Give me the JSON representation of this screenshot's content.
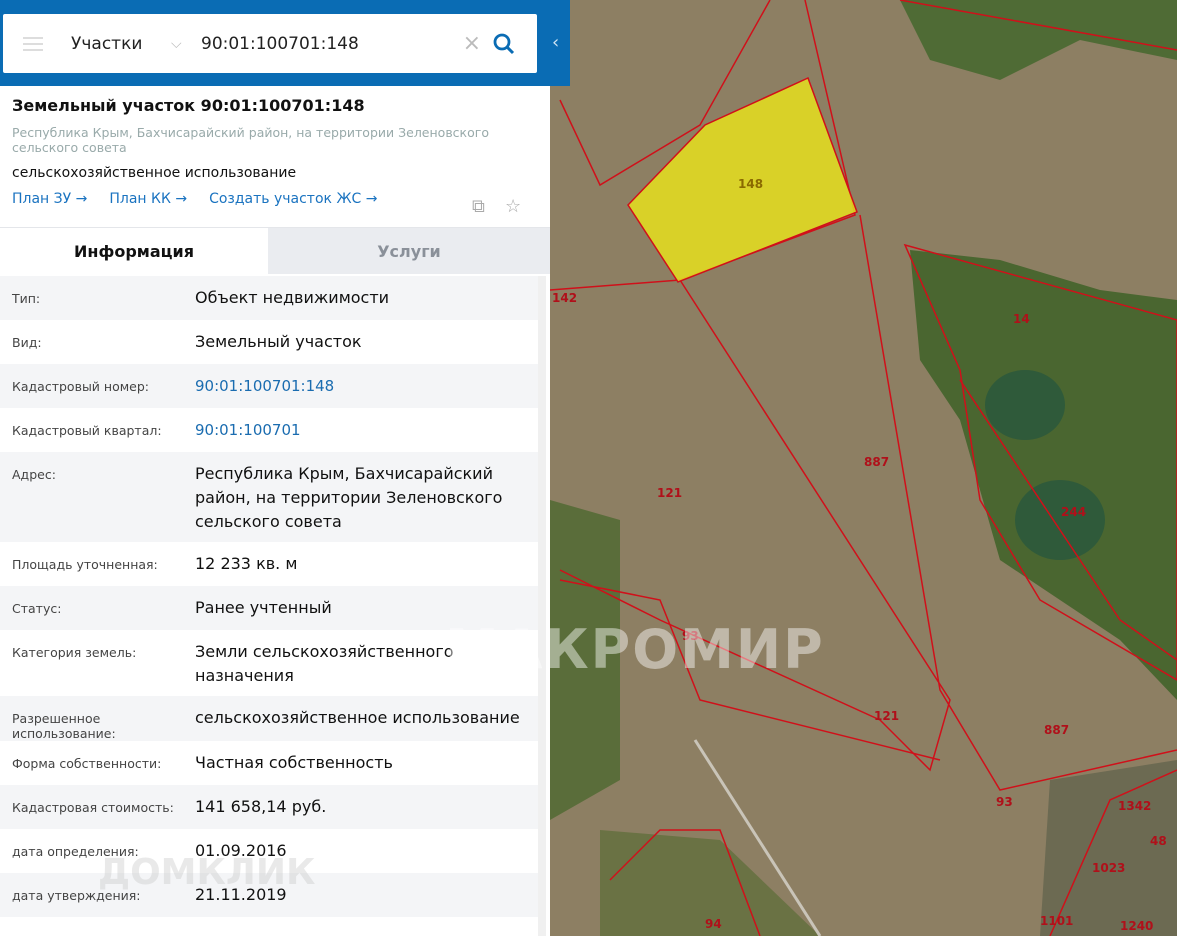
{
  "search": {
    "layer": "Участки",
    "query": "90:01:100701:148"
  },
  "card": {
    "title": "Земельный участок 90:01:100701:148",
    "address": "Республика Крым, Бахчисарайский район, на территории Зеленовского сельского совета",
    "use": "сельскохозяйственное использование",
    "links": [
      "План ЗУ →",
      "План КК →",
      "Создать участок ЖС →"
    ]
  },
  "tabs": [
    "Информация",
    "Услуги"
  ],
  "rows": [
    {
      "label": "Тип:",
      "value": "Объект недвижимости"
    },
    {
      "label": "Вид:",
      "value": "Земельный участок"
    },
    {
      "label": "Кадастровый номер:",
      "value": "90:01:100701:148"
    },
    {
      "label": "Кадастровый квартал:",
      "value": "90:01:100701"
    },
    {
      "label": "Адрес:",
      "value": "Республика Крым, Бахчисарайский район, на территории Зеленовского сельского совета"
    },
    {
      "label": "Площадь уточненная:",
      "value": "12 233 кв. м"
    },
    {
      "label": "Статус:",
      "value": "Ранее учтенный"
    },
    {
      "label": "Категория земель:",
      "value": "Земли сельскохозяйственного назначения"
    },
    {
      "label": "Разрешенное использование:",
      "value": "сельскохозяйственное использование"
    },
    {
      "label": "Форма собственности:",
      "value": "Частная собственность"
    },
    {
      "label": "Кадастровая стоимость:",
      "value": "141 658,14 руб."
    },
    {
      "label": "дата определения:",
      "value": "01.09.2016"
    },
    {
      "label": "дата утверждения:",
      "value": "21.11.2019"
    }
  ],
  "map_labels": [
    "148",
    "142",
    "14",
    "887",
    "121",
    "244",
    "93",
    "121",
    "887",
    "93",
    "1342",
    "48",
    "1023",
    "1240",
    "1101",
    "94"
  ],
  "watermarks": [
    "МАКРОМИР",
    "ДОМКЛИК"
  ]
}
